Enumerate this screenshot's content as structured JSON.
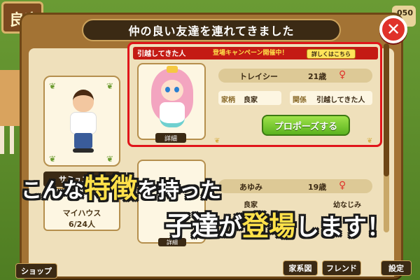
{
  "background": {
    "top_left_label": "良家",
    "score": "050"
  },
  "dialog": {
    "title": "仲の良い友達を連れてきました",
    "close_icon": "✕"
  },
  "friend": {
    "name": "サミュエ",
    "house_label": "マイハウス",
    "count": "6/24人"
  },
  "candidate": {
    "tag": "引越してきた人",
    "campaign": "登場キャンペーン開催中！",
    "detail_link": "詳しくはこちら",
    "name": "トレイシー",
    "age": "21歳",
    "gender_icon": "♀",
    "family_key": "家柄",
    "family_value": "良家",
    "relation_key": "関係",
    "relation_value": "引越してきた人",
    "detail_label": "詳細",
    "propose_label": "プロポーズする"
  },
  "candidate2": {
    "name": "あゆみ",
    "age": "19歳",
    "gender_icon": "♀",
    "family_value": "良家",
    "relation_value": "幼なじみ",
    "detail_label": "詳細"
  },
  "nav": {
    "shop": "ショップ",
    "family_tree": "家系図",
    "friend": "フレンド",
    "settings": "設定"
  },
  "promo": {
    "line1_a": "こんな",
    "line1_b": "特徴",
    "line1_c": "を持った",
    "line2_a": "子達",
    "line2_b": "が",
    "line2_c": "登場",
    "line2_d": "します！"
  },
  "colors": {
    "accent_red": "#e0151a",
    "propose_green": "#5bb31f",
    "panel_brown": "#3b2a14",
    "highlight_yellow": "#ffe14a"
  }
}
